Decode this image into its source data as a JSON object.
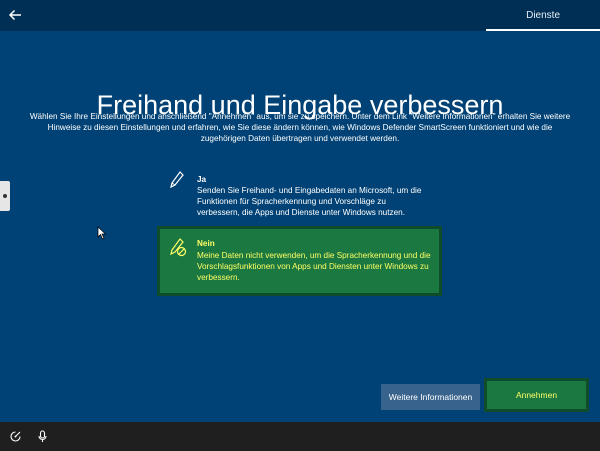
{
  "header": {
    "section_title": "Dienste",
    "back_icon": "back-arrow-icon"
  },
  "main": {
    "title": "Freihand und Eingabe verbessern",
    "intro": "Wählen Sie Ihre Einstellungen und anschließend \"Annehmen\" aus, um sie zu speichern. Unter dem Link \"Weitere Informationen\" erhalten Sie weitere Hinweise zu diesen Einstellungen und erfahren, wie Sie diese ändern können, wie Windows Defender SmartScreen funktioniert und wie die zugehörigen Daten übertragen und verwendet werden."
  },
  "options": [
    {
      "label": "Ja",
      "description": "Senden Sie Freihand- und Eingabedaten an Microsoft, um die Funktionen für Spracherkennung und Vorschläge zu verbessern, die Apps und Dienste unter Windows nutzen.",
      "selected": false,
      "icon": "pen-icon"
    },
    {
      "label": "Nein",
      "description": "Meine Daten nicht verwenden, um die Spracherkennung und die Vorschlagsfunktionen von Apps und Diensten unter Windows zu verbessern.",
      "selected": true,
      "icon": "pen-disabled-icon"
    }
  ],
  "buttons": {
    "more_info": "Weitere Informationen",
    "accept": "Annehmen"
  },
  "bottom_bar": {
    "icons": [
      "ease-of-access-icon",
      "microphone-icon"
    ]
  },
  "colors": {
    "background": "#004275",
    "topbar": "#002f55",
    "selected_green": "#1b7841",
    "selected_text": "#ffff66",
    "secondary_button": "#37638d",
    "bottombar": "#1f1f1f"
  }
}
